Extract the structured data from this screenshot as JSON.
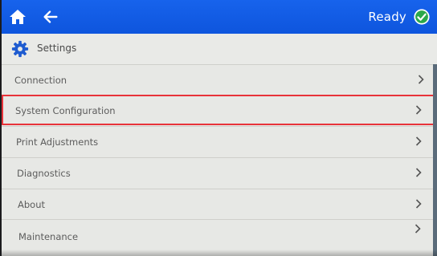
{
  "topbar": {
    "status_text": "Ready",
    "colors": {
      "bar": "#1763ec",
      "status_ok": "#2aa84a",
      "selection": "#e8333a"
    },
    "icons": [
      "home-icon",
      "back-arrow-icon",
      "status-ok-icon"
    ]
  },
  "header": {
    "title": "Settings",
    "icon": "gear-icon"
  },
  "menu": {
    "items": [
      {
        "label": "Connection"
      },
      {
        "label": "System Configuration",
        "selected": true
      },
      {
        "label": "Print Adjustments"
      },
      {
        "label": "Diagnostics"
      },
      {
        "label": "About"
      },
      {
        "label": "Maintenance"
      }
    ]
  }
}
